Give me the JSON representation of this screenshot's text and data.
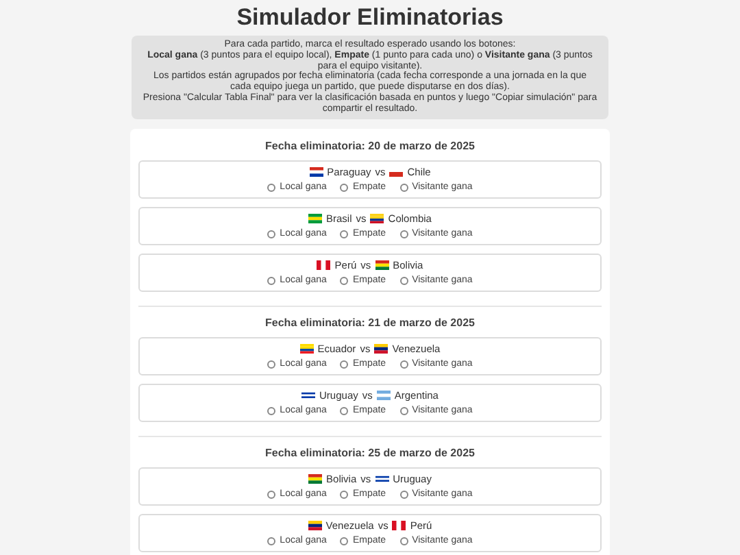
{
  "title": "Simulador Eliminatorias",
  "instructions": [
    "Para cada partido, marca el resultado esperado usando los botones:",
    "**Local gana** (3 puntos para el equipo local), **Empate** (1 punto para cada uno) o **Visitante gana** (3 puntos para el equipo visitante).",
    "Los partidos están agrupados por fecha eliminatoria (cada fecha corresponde a una jornada en la que cada equipo juega un partido, que puede disputarse en dos días).",
    "Presiona \"Calcular Tabla Final\" para ver la clasificación basada en puntos y luego \"Copiar simulación\" para compartir el resultado."
  ],
  "rounds": [
    {
      "heading": "Fecha eliminatoria: 20 de marzo de 2025",
      "matches": [
        {
          "home": {
            "name": "Paraguay",
            "kind": "paraguay"
          },
          "vs": "vs",
          "away": {
            "name": "Chile",
            "kind": "chile"
          },
          "options": [
            {
              "label": "Local gana",
              "selected": false
            },
            {
              "label": "Empate",
              "selected": false
            },
            {
              "label": "Visitante gana",
              "selected": false
            }
          ]
        },
        {
          "home": {
            "name": "Brasil",
            "kind": "brasil"
          },
          "vs": "vs",
          "away": {
            "name": "Colombia",
            "kind": "colombia"
          },
          "options": [
            {
              "label": "Local gana",
              "selected": false
            },
            {
              "label": "Empate",
              "selected": false
            },
            {
              "label": "Visitante gana",
              "selected": false
            }
          ]
        },
        {
          "home": {
            "name": "Perú",
            "kind": "peru"
          },
          "vs": "vs",
          "away": {
            "name": "Bolivia",
            "kind": "bolivia"
          },
          "options": [
            {
              "label": "Local gana",
              "selected": false
            },
            {
              "label": "Empate",
              "selected": false
            },
            {
              "label": "Visitante gana",
              "selected": false
            }
          ]
        }
      ]
    },
    {
      "heading": "Fecha eliminatoria: 21 de marzo de 2025",
      "matches": [
        {
          "home": {
            "name": "Ecuador",
            "kind": "ecuador"
          },
          "vs": "vs",
          "away": {
            "name": "Venezuela",
            "kind": "venezuela"
          },
          "options": [
            {
              "label": "Local gana",
              "selected": false
            },
            {
              "label": "Empate",
              "selected": false
            },
            {
              "label": "Visitante gana",
              "selected": false
            }
          ]
        },
        {
          "home": {
            "name": "Uruguay",
            "kind": "uruguay"
          },
          "vs": "vs",
          "away": {
            "name": "Argentina",
            "kind": "argentina"
          },
          "options": [
            {
              "label": "Local gana",
              "selected": false
            },
            {
              "label": "Empate",
              "selected": false
            },
            {
              "label": "Visitante gana",
              "selected": false
            }
          ]
        }
      ]
    },
    {
      "heading": "Fecha eliminatoria: 25 de marzo de 2025",
      "matches": [
        {
          "home": {
            "name": "Bolivia",
            "kind": "bolivia"
          },
          "vs": "vs",
          "away": {
            "name": "Uruguay",
            "kind": "uruguay"
          },
          "options": [
            {
              "label": "Local gana",
              "selected": false
            },
            {
              "label": "Empate",
              "selected": false
            },
            {
              "label": "Visitante gana",
              "selected": false
            }
          ]
        },
        {
          "home": {
            "name": "Venezuela",
            "kind": "venezuela"
          },
          "vs": "vs",
          "away": {
            "name": "Perú",
            "kind": "peru"
          },
          "options": [
            {
              "label": "Local gana",
              "selected": false
            },
            {
              "label": "Empate",
              "selected": false
            },
            {
              "label": "Visitante gana",
              "selected": false
            }
          ]
        }
      ]
    }
  ]
}
